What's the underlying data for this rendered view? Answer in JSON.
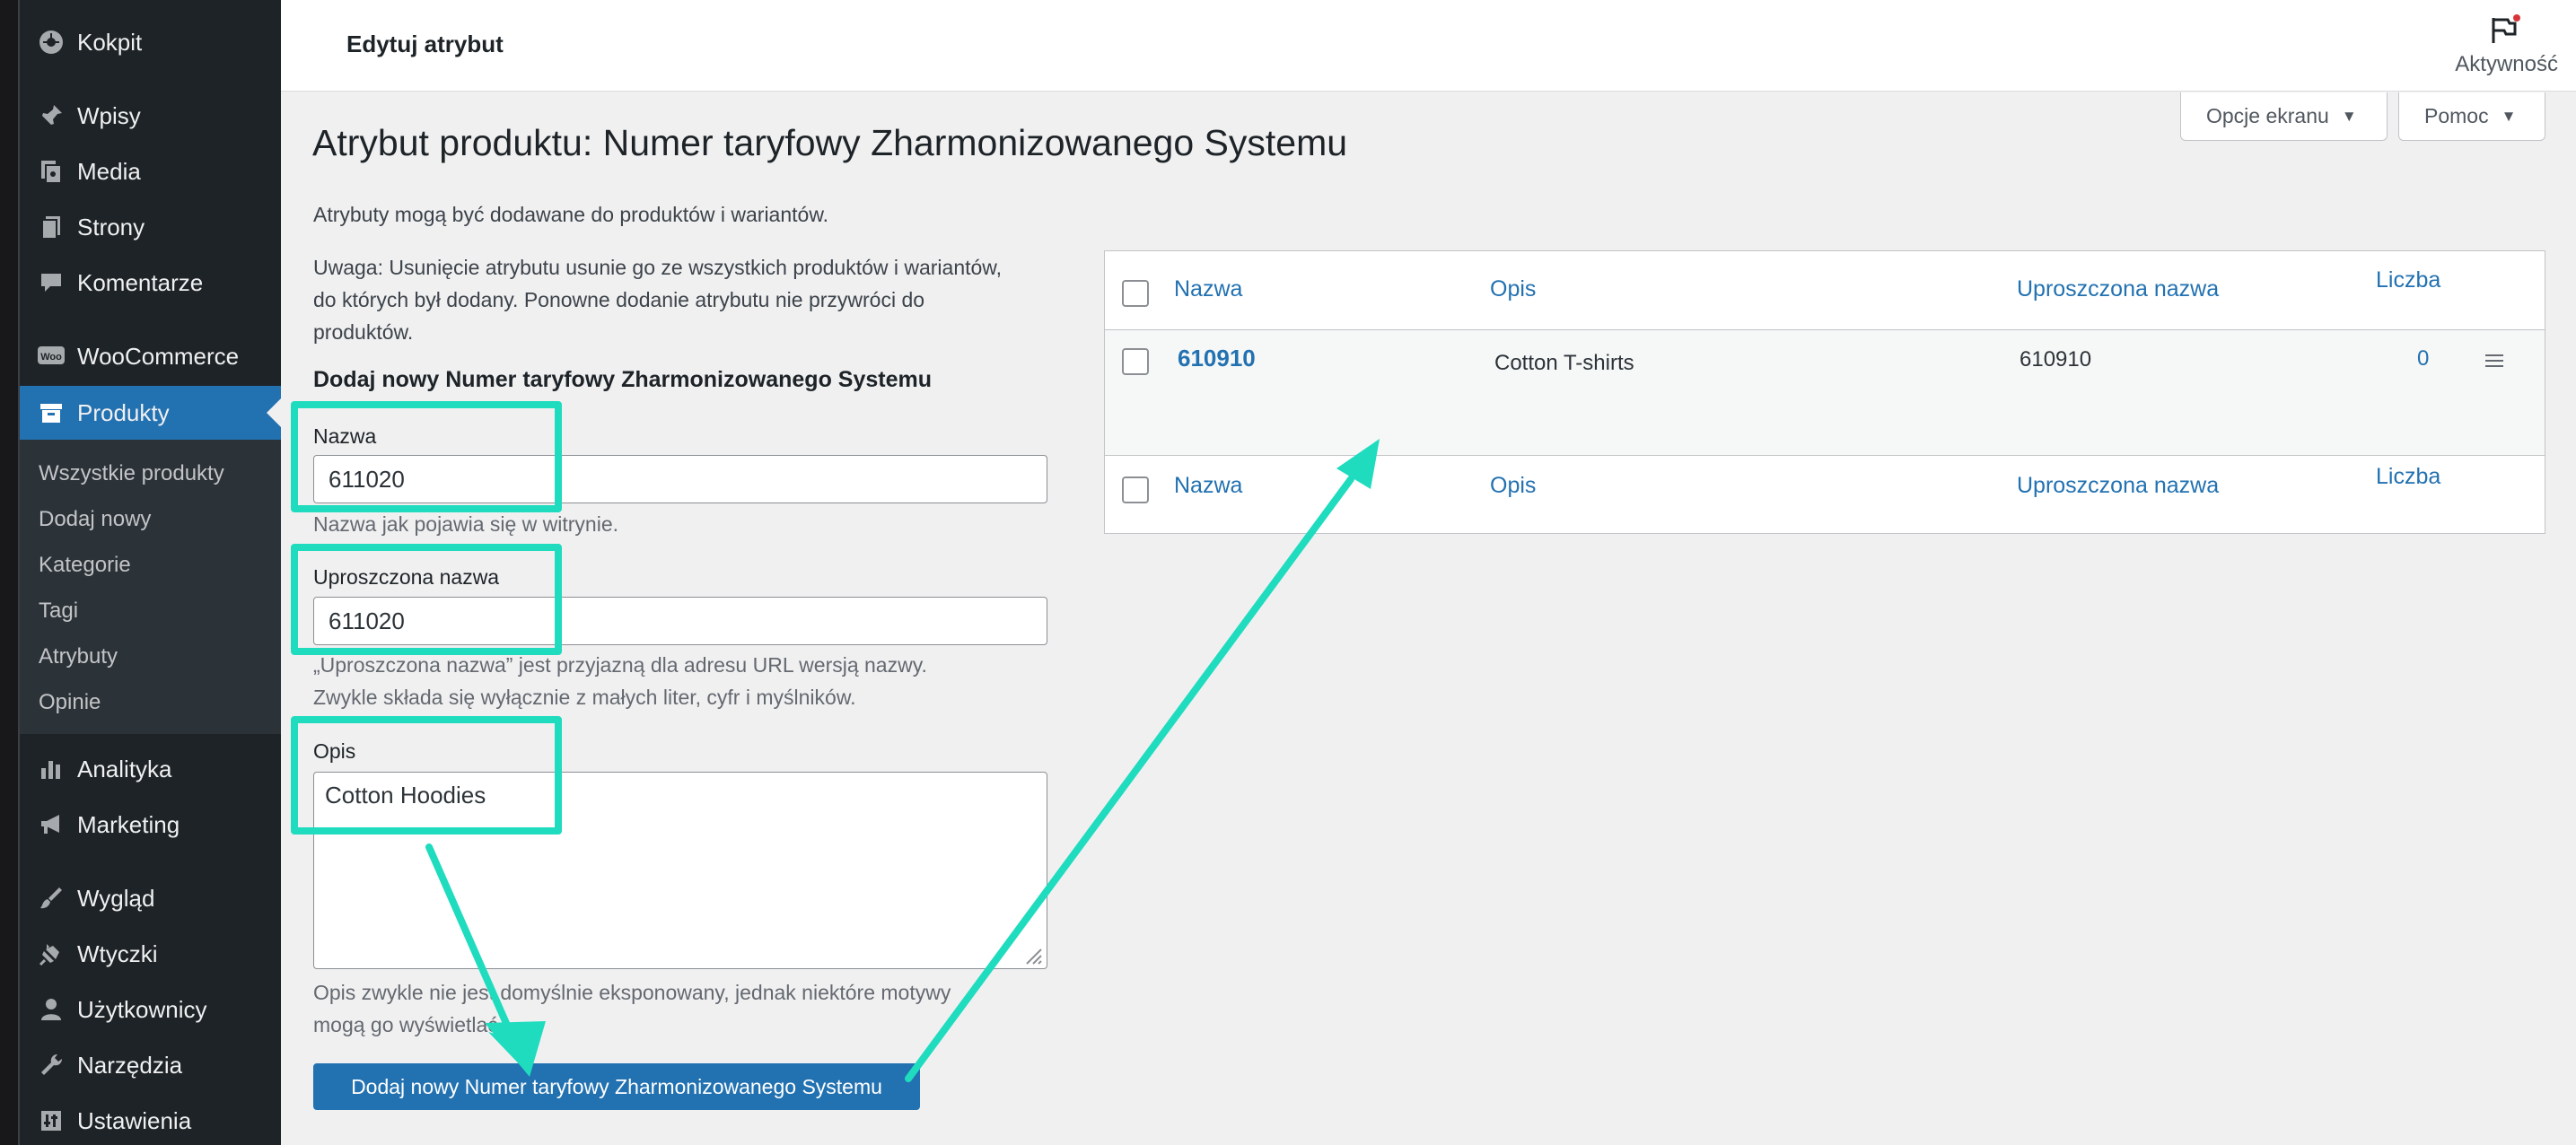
{
  "sidebar": {
    "items": [
      {
        "label": "Kokpit",
        "icon": "dashboard-icon"
      },
      {
        "label": "Wpisy",
        "icon": "pin-icon"
      },
      {
        "label": "Media",
        "icon": "media-icon"
      },
      {
        "label": "Strony",
        "icon": "page-icon"
      },
      {
        "label": "Komentarze",
        "icon": "comment-icon"
      },
      {
        "label": "WooCommerce",
        "icon": "woo-icon"
      },
      {
        "label": "Produkty",
        "icon": "archive-icon",
        "active": true
      },
      {
        "label": "Analityka",
        "icon": "chart-icon"
      },
      {
        "label": "Marketing",
        "icon": "megaphone-icon"
      },
      {
        "label": "Wygląd",
        "icon": "brush-icon"
      },
      {
        "label": "Wtyczki",
        "icon": "plugin-icon"
      },
      {
        "label": "Użytkownicy",
        "icon": "user-icon"
      },
      {
        "label": "Narzędzia",
        "icon": "wrench-icon"
      },
      {
        "label": "Ustawienia",
        "icon": "settings-icon"
      }
    ],
    "submenu": [
      "Wszystkie produkty",
      "Dodaj nowy",
      "Kategorie",
      "Tagi",
      "Atrybuty",
      "Opinie"
    ]
  },
  "topbar": {
    "title": "Edytuj atrybut",
    "activity_label": "Aktywność"
  },
  "screen_meta": {
    "screen_options": "Opcje ekranu",
    "help": "Pomoc"
  },
  "page": {
    "title": "Atrybut produktu: Numer taryfowy Zharmonizowanego Systemu",
    "intro": "Atrybuty mogą być dodawane do produktów i wariantów.",
    "note_line1": "Uwaga: Usunięcie atrybutu usunie go ze wszystkich produktów i wariantów,",
    "note_line2": "do których był dodany. Ponowne dodanie atrybutu nie przywróci do",
    "note_line3": "produktów."
  },
  "form": {
    "heading": "Dodaj nowy Numer taryfowy Zharmonizowanego Systemu",
    "name_label": "Nazwa",
    "name_value": "611020",
    "name_help": "Nazwa jak pojawia się w witrynie.",
    "slug_label": "Uproszczona nazwa",
    "slug_value": "611020",
    "slug_help_line1": "„Uproszczona nazwa” jest przyjazną dla adresu URL wersją nazwy.",
    "slug_help_line2": "Zwykle składa się wyłącznie z małych liter, cyfr i myślników.",
    "desc_label": "Opis",
    "desc_value": "Cotton Hoodies",
    "desc_help_line1": "Opis zwykle nie jest domyślnie eksponowany, jednak niektóre motywy",
    "desc_help_line2": "mogą go wyświetlać.",
    "submit_label": "Dodaj nowy Numer taryfowy Zharmonizowanego Systemu"
  },
  "table": {
    "columns": {
      "name": "Nazwa",
      "description": "Opis",
      "slug": "Uproszczona nazwa",
      "count": "Liczba"
    },
    "rows": [
      {
        "name": "610910",
        "description": "Cotton T-shirts",
        "slug": "610910",
        "count": "0"
      }
    ]
  },
  "colors": {
    "accent": "#2271b1",
    "highlight": "#1fdcbf",
    "sidebar_bg": "#1d2327",
    "notification_dot": "#d63638"
  }
}
